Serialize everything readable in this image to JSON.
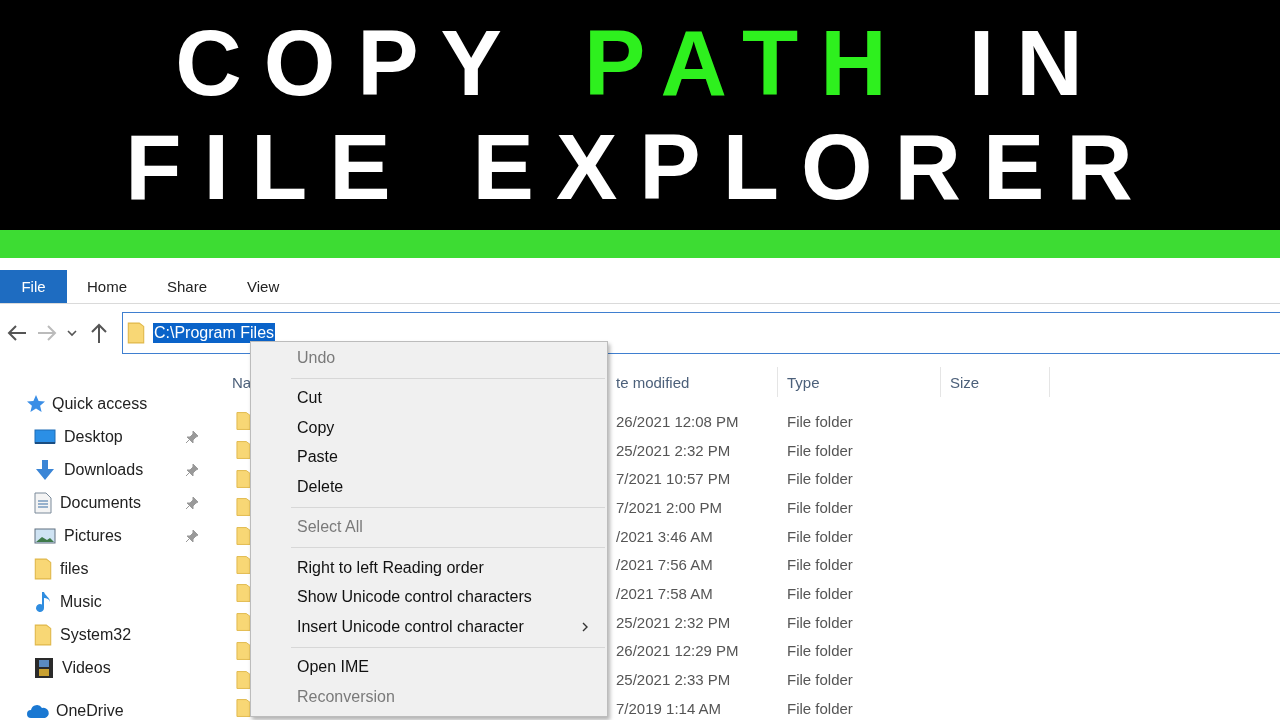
{
  "banner": {
    "lines": [
      [
        {
          "text": "COPY",
          "highlight": false
        },
        {
          "text": "PATH",
          "highlight": true
        },
        {
          "text": "IN",
          "highlight": false
        }
      ],
      [
        {
          "text": "FILE",
          "highlight": false
        },
        {
          "text": "EXPLORER",
          "highlight": false
        }
      ]
    ]
  },
  "ribbon": {
    "tabs": [
      {
        "label": "File",
        "selected": true
      },
      {
        "label": "Home",
        "selected": false
      },
      {
        "label": "Share",
        "selected": false
      },
      {
        "label": "View",
        "selected": false
      }
    ]
  },
  "address": {
    "value": "C:\\Program Files",
    "text_selected": true
  },
  "sidebar": {
    "items": [
      {
        "label": "Quick access",
        "kind": "star",
        "children": [
          {
            "label": "Desktop",
            "kind": "desktop",
            "pinned": true
          },
          {
            "label": "Downloads",
            "kind": "download",
            "pinned": true
          },
          {
            "label": "Documents",
            "kind": "document",
            "pinned": true
          },
          {
            "label": "Pictures",
            "kind": "picture",
            "pinned": true
          },
          {
            "label": "files",
            "kind": "folder",
            "pinned": false
          },
          {
            "label": "Music",
            "kind": "music",
            "pinned": false
          },
          {
            "label": "System32",
            "kind": "folder",
            "pinned": false
          },
          {
            "label": "Videos",
            "kind": "video",
            "pinned": false
          }
        ]
      },
      {
        "label": "OneDrive",
        "kind": "cloud"
      }
    ]
  },
  "table": {
    "columns": [
      "Na",
      "te modified",
      "Type",
      "Size"
    ],
    "rows": [
      {
        "date": "26/2021 12:08 PM",
        "type": "File folder"
      },
      {
        "date": "25/2021 2:32 PM",
        "type": "File folder"
      },
      {
        "date": "7/2021 10:57 PM",
        "type": "File folder"
      },
      {
        "date": "7/2021 2:00 PM",
        "type": "File folder"
      },
      {
        "date": "/2021 3:46 AM",
        "type": "File folder"
      },
      {
        "date": "/2021 7:56 AM",
        "type": "File folder"
      },
      {
        "date": "/2021 7:58 AM",
        "type": "File folder"
      },
      {
        "date": "25/2021 2:32 PM",
        "type": "File folder"
      },
      {
        "date": "26/2021 12:29 PM",
        "type": "File folder"
      },
      {
        "date": "25/2021 2:33 PM",
        "type": "File folder"
      },
      {
        "date": "7/2019 1:14 AM",
        "type": "File folder"
      }
    ]
  },
  "context_menu": {
    "groups": [
      [
        {
          "label": "Undo",
          "disabled": true,
          "submenu": false
        }
      ],
      [
        {
          "label": "Cut",
          "disabled": false,
          "submenu": false
        },
        {
          "label": "Copy",
          "disabled": false,
          "submenu": false
        },
        {
          "label": "Paste",
          "disabled": false,
          "submenu": false
        },
        {
          "label": "Delete",
          "disabled": false,
          "submenu": false
        }
      ],
      [
        {
          "label": "Select All",
          "disabled": true,
          "submenu": false
        }
      ],
      [
        {
          "label": "Right to left Reading order",
          "disabled": false,
          "submenu": false
        },
        {
          "label": "Show Unicode control characters",
          "disabled": false,
          "submenu": false
        },
        {
          "label": "Insert Unicode control character",
          "disabled": false,
          "submenu": true
        }
      ],
      [
        {
          "label": "Open IME",
          "disabled": false,
          "submenu": false
        },
        {
          "label": "Reconversion",
          "disabled": true,
          "submenu": false
        }
      ]
    ]
  }
}
